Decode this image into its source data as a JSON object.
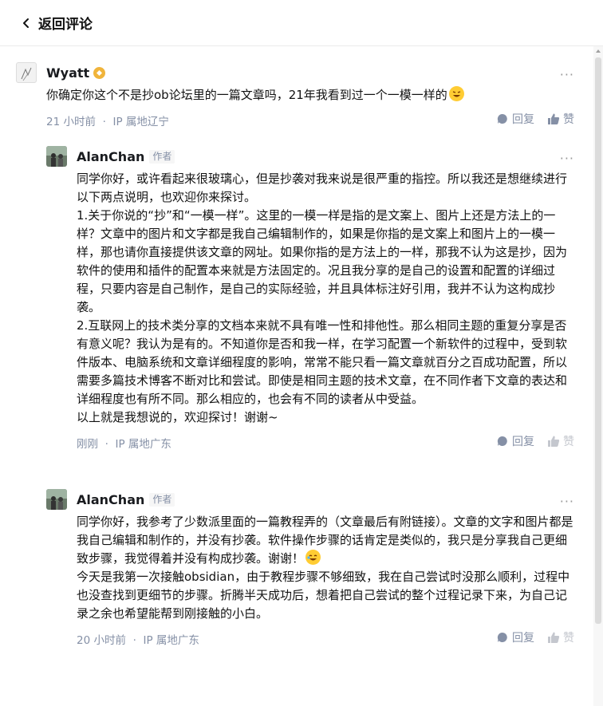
{
  "header": {
    "back_label": "返回评论"
  },
  "root_comment": {
    "author": "Wyatt",
    "text": "你确定你这个不是抄ob论坛里的一篇文章吗，21年我看到过一个一模一样的",
    "time": "21 小时前",
    "ip": "IP 属地辽宁",
    "reply_label": "回复",
    "like_label": "赞"
  },
  "replies": [
    {
      "author": "AlanChan",
      "role": "作者",
      "paragraphs": [
        "同学你好，或许看起来很玻璃心，但是抄袭对我来说是很严重的指控。所以我还是想继续进行以下两点说明，也欢迎你来探讨。",
        "1.关于你说的“抄”和“一模一样”。这里的一模一样是指的是文案上、图片上还是方法上的一样？文章中的图片和文字都是我自己编辑制作的，如果是你指的是文案上和图片上的一模一样，那也请你直接提供该文章的网址。如果你指的是方法上的一样，那我不认为这是抄，因为软件的使用和插件的配置本来就是方法固定的。况且我分享的是自己的设置和配置的详细过程，只要内容是自己制作，是自己的实际经验，并且具体标注好引用，我并不认为这构成抄袭。",
        "2.互联网上的技术类分享的文档本来就不具有唯一性和排他性。那么相同主题的重复分享是否有意义呢？我认为是有的。不知道你是否和我一样，在学习配置一个新软件的过程中，受到软件版本、电脑系统和文章详细程度的影响，常常不能只看一篇文章就百分之百成功配置，所以需要多篇技术博客不断对比和尝试。即使是相同主题的技术文章，在不同作者下文章的表达和详细程度也有所不同。那么相应的，也会有不同的读者从中受益。",
        "以上就是我想说的，欢迎探讨！谢谢~"
      ],
      "time": "刚刚",
      "ip": "IP 属地广东",
      "reply_label": "回复",
      "like_label": "赞"
    },
    {
      "author": "AlanChan",
      "role": "作者",
      "paragraphs": [
        "同学你好，我参考了少数派里面的一篇教程弄的（文章最后有附链接）。文章的文字和图片都是我自己编辑和制作的，并没有抄袭。软件操作步骤的话肯定是类似的，我只是分享我自己更细致步骤，我觉得着并没有构成抄袭。谢谢！",
        "今天是我第一次接触obsidian，由于教程步骤不够细致，我在自己尝试时没那么顺利，过程中也没查找到更细节的步骤。折腾半天成功后，想着把自己尝试的整个过程记录下来，为自己记录之余也希望能帮到刚接触的小白。"
      ],
      "time": "20 小时前",
      "ip": "IP 属地广东",
      "reply_label": "回复",
      "like_label": "赞"
    }
  ],
  "meta_separator": "·",
  "more_glyph": "···",
  "colors": {
    "meta": "#8590a6",
    "text": "#121212",
    "badge": "#f0b43b",
    "like_disabled": "#c4c7ce"
  }
}
